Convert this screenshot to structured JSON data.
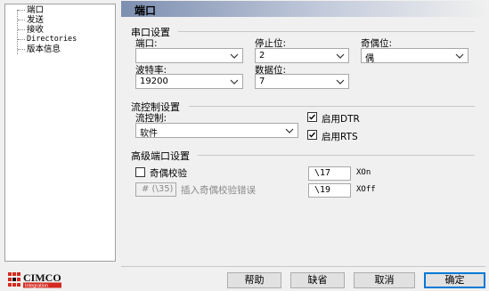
{
  "tree": {
    "items": [
      "端口",
      "发送",
      "接收",
      "Directories",
      "版本信息"
    ]
  },
  "header": {
    "title": "端口"
  },
  "serial": {
    "group_title": "串口设置",
    "port_label": "端口:",
    "port_value": "",
    "stopbits_label": "停止位:",
    "stopbits_value": "2",
    "parity_label": "奇偶位:",
    "parity_value": "偶",
    "baud_label": "波特率:",
    "baud_value": "19200",
    "databits_label": "数据位:",
    "databits_value": "7"
  },
  "flow": {
    "group_title": "流控制设置",
    "flow_label": "流控制:",
    "flow_value": "软件",
    "dtr_label": "启用DTR",
    "dtr_checked": true,
    "rts_label": "启用RTS",
    "rts_checked": true
  },
  "advanced": {
    "group_title": "高级端口设置",
    "parity_check_label": "奇偶校验",
    "parity_check_checked": false,
    "insert_char_value": "# (\\35)",
    "insert_char_label": "插入奇偶校验错误",
    "xon_value": "\\17",
    "xon_label": "XOn",
    "xoff_value": "\\19",
    "xoff_label": "XOff"
  },
  "buttons": {
    "help": "帮助",
    "default": "缺省",
    "cancel": "取消",
    "ok": "确定"
  },
  "logo": {
    "text": "CIMCO",
    "subtext": "Integration"
  },
  "colors": {
    "accent": "#0078d7",
    "header_gradient_start": "#7d8fb0",
    "logo_red": "#d42a20"
  }
}
